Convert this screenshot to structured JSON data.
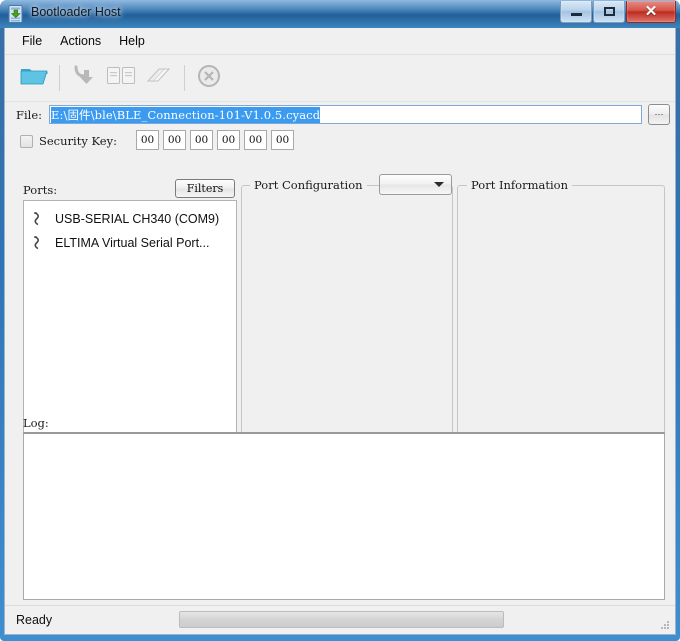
{
  "window": {
    "title": "Bootloader Host",
    "icon": "bootloader-document-download-icon",
    "caption_buttons": [
      {
        "name": "minimize",
        "glyph": "–"
      },
      {
        "name": "maximize",
        "glyph": "□"
      },
      {
        "name": "close",
        "glyph": "✕"
      }
    ]
  },
  "menubar": {
    "items": [
      {
        "label": "File"
      },
      {
        "label": "Actions"
      },
      {
        "label": "Help"
      }
    ]
  },
  "toolbar": {
    "buttons": [
      {
        "name": "open-file-icon",
        "enabled": true
      },
      {
        "name": "program-download-icon",
        "enabled": false
      },
      {
        "name": "verify-documents-icon",
        "enabled": false
      },
      {
        "name": "erase-icon",
        "enabled": false
      },
      {
        "name": "abort-cancel-icon",
        "enabled": false
      }
    ]
  },
  "file_row": {
    "label": "File:",
    "value": "E:\\固件\\ble\\BLE_Connection-101-V1.0.5.cyacd",
    "placeholder": "",
    "browse_label": "...",
    "selected": true,
    "selection_color": "#3b9bf0"
  },
  "security_key": {
    "label": "Security Key:",
    "checked": false,
    "separator": ",",
    "bytes": [
      "00",
      "00",
      "00",
      "00",
      "00",
      "00"
    ]
  },
  "ports": {
    "label": "Ports:",
    "filters_label": "Filters",
    "items": [
      {
        "label": "USB-SERIAL CH340 (COM9)",
        "icon": "serial-port-icon"
      },
      {
        "label": "ELTIMA Virtual Serial Port...",
        "icon": "serial-port-icon"
      }
    ]
  },
  "port_configuration": {
    "caption": "Port Configuration",
    "combo_value": "",
    "combo_options": []
  },
  "port_information": {
    "caption": "Port Information",
    "content": ""
  },
  "log": {
    "label": "Log:",
    "content": ""
  },
  "statusbar": {
    "status": "Ready",
    "progress_percent": 0
  },
  "colors": {
    "title_bar": "#2b6ca8",
    "close_button": "#bc2b20",
    "selection": "#3b9bf0",
    "client_bg": "#f0f0f0",
    "open_icon": "#4cb6dd"
  }
}
